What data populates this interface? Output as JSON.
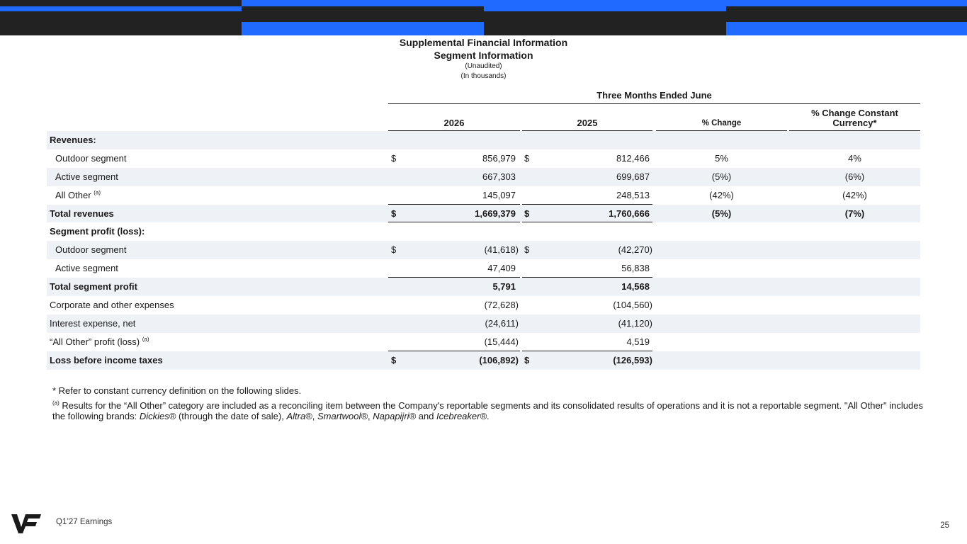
{
  "header": {
    "title": "Supplemental Financial Information",
    "subtitle": "Segment Information",
    "note1": "(Unaudited)",
    "note2": "(In thousands)",
    "period": "Three Months Ended June"
  },
  "columns": {
    "y2026": "2026",
    "y2025": "2025",
    "pct": "% Change",
    "pct_cc": "% Change Constant Currency*"
  },
  "rows": [
    {
      "label": "Revenues:"
    },
    {
      "label": "Outdoor segment",
      "cur26": "$",
      "v26": "856,979",
      "cur25": "$",
      "v25": "812,466",
      "pct": "5%",
      "pct_cc": "4%"
    },
    {
      "label": "Active segment",
      "v26": "667,303",
      "v25": "699,687",
      "pct": "(5%)",
      "pct_cc": "(6%)"
    },
    {
      "label": "All Other",
      "sup": "(a)",
      "v26": "145,097",
      "v25": "248,513",
      "pct": "(42%)",
      "pct_cc": "(42%)"
    },
    {
      "label": "Total revenues",
      "cur26": "$",
      "v26": "1,669,379",
      "cur25": "$",
      "v25": "1,760,666",
      "pct": "(5%)",
      "pct_cc": "(7%)"
    },
    {
      "label": "Segment profit (loss):"
    },
    {
      "label": "Outdoor segment",
      "cur26": "$",
      "v26": "(41,618)",
      "cur25": "$",
      "v25": "(42,270)"
    },
    {
      "label": "Active segment",
      "v26": "47,409",
      "v25": "56,838"
    },
    {
      "label": "Total segment profit",
      "v26": "5,791",
      "v25": "14,568"
    },
    {
      "label": "Corporate and other expenses",
      "v26": "(72,628)",
      "v25": "(104,560)"
    },
    {
      "label": "Interest expense, net",
      "v26": "(24,611)",
      "v25": "(41,120)"
    },
    {
      "label": "“All Other” profit (loss)",
      "sup": "(a)",
      "v26": "(15,444)",
      "v25": "4,519"
    },
    {
      "label": "Loss before income taxes",
      "cur26": "$",
      "v26": "(106,892)",
      "cur25": "$",
      "v25": "(126,593)"
    }
  ],
  "notes": {
    "star": "* Refer to constant currency definition on the following slides.",
    "a_marker": "(a)",
    "a_p1": " Results for the “All Other” category are included as a reconciling item between the Company's reportable segments and its consolidated results of operations and it is not a reportable segment. \"All Other\" includes the following brands: ",
    "brand1": "Dickies®",
    "a_p2": " (through the date of sale), ",
    "brand2": "Altra®",
    "sep1": ", ",
    "brand3": "Smartwool®",
    "sep2": ", ",
    "brand4": "Napapijri®",
    "and": " and ",
    "brand5": "Icebreaker®",
    "end": "."
  },
  "footer": {
    "left": "Q1’27 Earnings",
    "page": "25"
  },
  "colors": {
    "accent_blue": "#1f6bff",
    "banner_dark": "#222222",
    "row_shade": "#eef1f6"
  },
  "icons": {
    "logo": "vf-logo-icon"
  }
}
